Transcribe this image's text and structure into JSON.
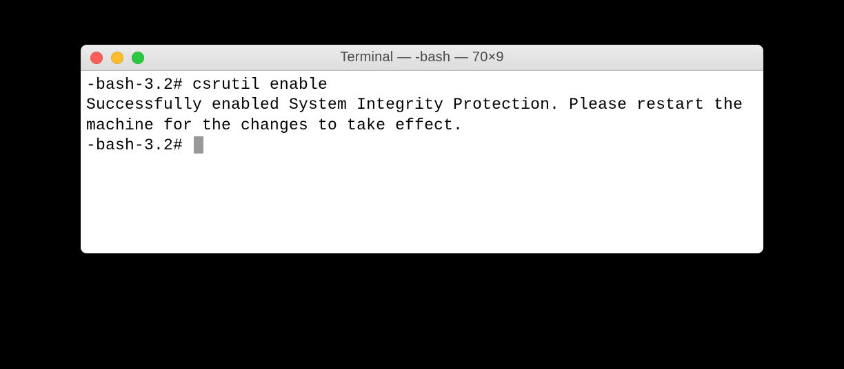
{
  "window": {
    "title": "Terminal — -bash — 70×9"
  },
  "terminal": {
    "line1_prompt": "-bash-3.2# ",
    "line1_command": "csrutil enable",
    "line2_output": "Successfully enabled System Integrity Protection. Please restart the machine for the changes to take effect.",
    "line3_prompt": "-bash-3.2# "
  }
}
